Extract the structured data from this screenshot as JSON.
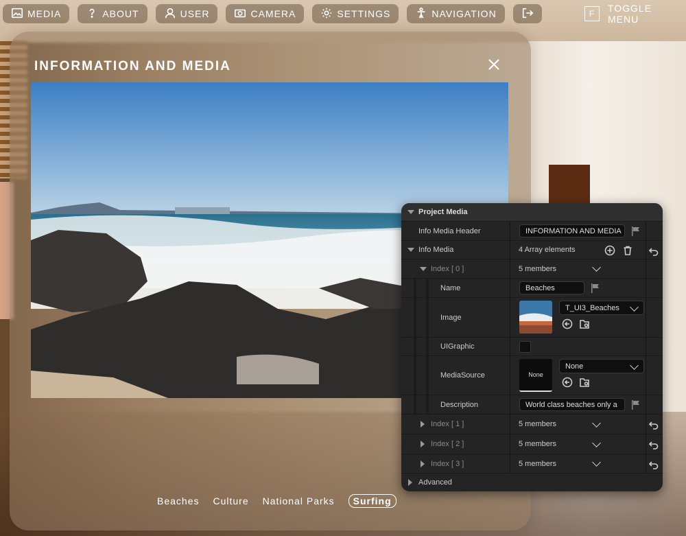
{
  "toolbar": {
    "items": [
      {
        "label": "MEDIA",
        "icon": "image-icon"
      },
      {
        "label": "ABOUT",
        "icon": "question-icon"
      },
      {
        "label": "USER",
        "icon": "user-icon"
      },
      {
        "label": "CAMERA",
        "icon": "camera-icon"
      },
      {
        "label": "SETTINGS",
        "icon": "gear-icon"
      },
      {
        "label": "NAVIGATION",
        "icon": "person-icon"
      },
      {
        "label": "",
        "icon": "exit-icon"
      }
    ],
    "toggle_letter": "F",
    "toggle_label": "TOGGLE MENU"
  },
  "info_panel": {
    "title": "INFORMATION AND MEDIA",
    "tabs": [
      "Beaches",
      "Culture",
      "National Parks",
      "Surfing"
    ],
    "active_tab": "Surfing"
  },
  "editor": {
    "section_title": "Project Media",
    "header_label": "Info Media Header",
    "header_value": "INFORMATION AND MEDIA",
    "info_media_label": "Info Media",
    "info_media_count": "4 Array elements",
    "index0": {
      "label": "Index [ 0 ]",
      "members": "5 members",
      "name_label": "Name",
      "name_value": "Beaches",
      "image_label": "Image",
      "image_value": "T_UI3_Beaches",
      "uigraphic_label": "UIGraphic",
      "mediasource_label": "MediaSource",
      "mediasource_thumb": "None",
      "mediasource_value": "None",
      "description_label": "Description",
      "description_value": "World class beaches only a"
    },
    "index_rows": [
      {
        "label": "Index [ 1 ]",
        "members": "5 members"
      },
      {
        "label": "Index [ 2 ]",
        "members": "5 members"
      },
      {
        "label": "Index [ 3 ]",
        "members": "5 members"
      }
    ],
    "advanced_label": "Advanced"
  }
}
